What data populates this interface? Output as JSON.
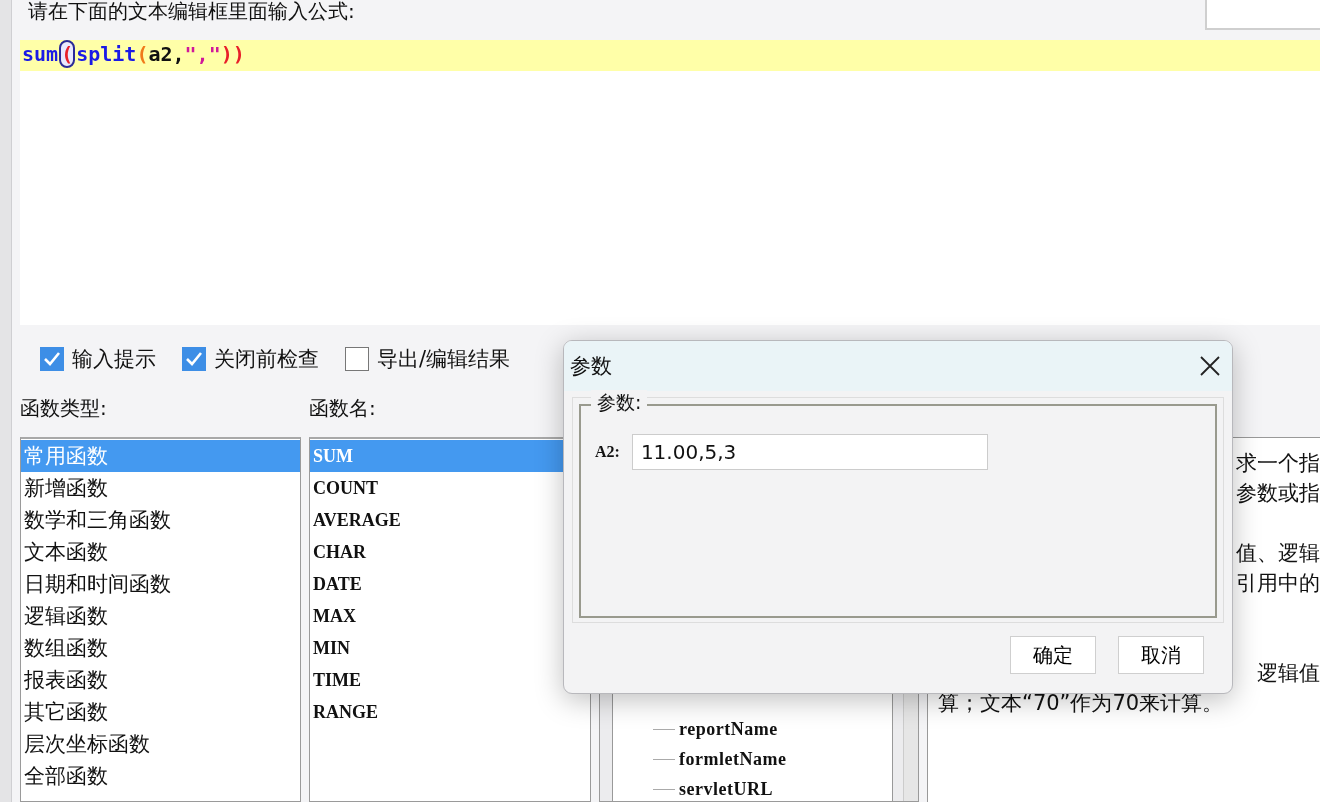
{
  "prompt": "请在下面的文本编辑框里面输入公式:",
  "formula": [
    {
      "kind": "function",
      "text": "sum",
      "matched": false
    },
    {
      "kind": "paren1",
      "text": "(",
      "matched": true
    },
    {
      "kind": "function",
      "text": "split",
      "matched": false
    },
    {
      "kind": "paren2",
      "text": "(",
      "matched": false
    },
    {
      "kind": "ident",
      "text": "a2,",
      "matched": false
    },
    {
      "kind": "string",
      "text": "\",\"",
      "matched": false
    },
    {
      "kind": "paren1",
      "text": "))",
      "matched": false
    }
  ],
  "options": [
    {
      "label": "输入提示",
      "checked": true
    },
    {
      "label": "关闭前检查",
      "checked": true
    },
    {
      "label": "导出/编辑结果",
      "checked": false
    }
  ],
  "function_types": {
    "label": "函数类型:",
    "items": [
      {
        "text": "常用函数",
        "selected": true
      },
      {
        "text": "新增函数",
        "selected": false
      },
      {
        "text": "数学和三角函数",
        "selected": false
      },
      {
        "text": "文本函数",
        "selected": false
      },
      {
        "text": "日期和时间函数",
        "selected": false
      },
      {
        "text": "逻辑函数",
        "selected": false
      },
      {
        "text": "数组函数",
        "selected": false
      },
      {
        "text": "报表函数",
        "selected": false
      },
      {
        "text": "其它函数",
        "selected": false
      },
      {
        "text": "层次坐标函数",
        "selected": false
      },
      {
        "text": "全部函数",
        "selected": false
      }
    ]
  },
  "function_names": {
    "label": "函数名:",
    "items": [
      {
        "text": "SUM",
        "selected": true
      },
      {
        "text": "COUNT",
        "selected": false
      },
      {
        "text": "AVERAGE",
        "selected": false
      },
      {
        "text": "CHAR",
        "selected": false
      },
      {
        "text": "DATE",
        "selected": false
      },
      {
        "text": "MAX",
        "selected": false
      },
      {
        "text": "MIN",
        "selected": false
      },
      {
        "text": "TIME",
        "selected": false
      },
      {
        "text": "RANGE",
        "selected": false
      }
    ]
  },
  "tree": [
    "reportName",
    "formletName",
    "servletURL"
  ],
  "description": [
    "求一个指",
    "参数或指",
    "值、逻辑",
    "引用中的",
    "逻辑值",
    "算；文本“70”作为70来计算。"
  ],
  "dialog": {
    "title": "参数",
    "group": "参数:",
    "field_label": "A2:",
    "value": "11.00,5,3",
    "buttons": [
      "确定",
      "取消"
    ]
  }
}
